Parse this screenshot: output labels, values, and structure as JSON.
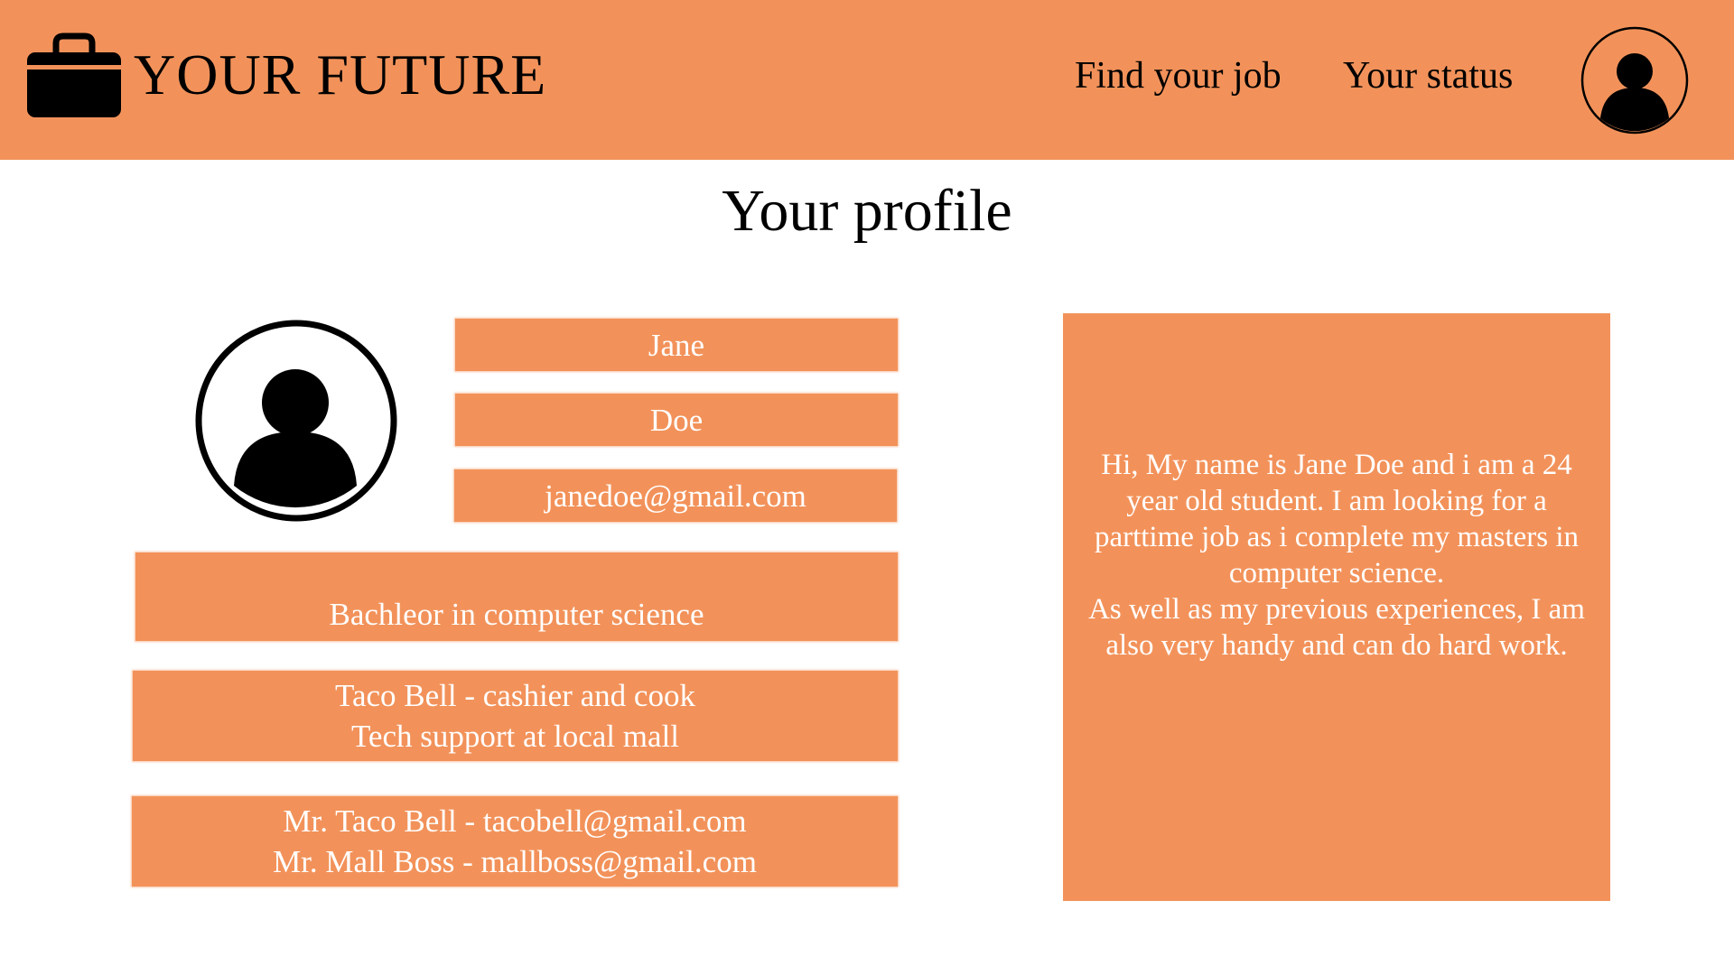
{
  "header": {
    "brand_icon": "briefcase-icon",
    "brand_name": "YOUR FUTURE",
    "nav": {
      "find_job": "Find your job",
      "status": "Your status"
    },
    "avatar_icon": "user-avatar-icon"
  },
  "page": {
    "title": "Your profile"
  },
  "profile": {
    "photo_icon": "user-avatar-icon",
    "first_name": "Jane",
    "last_name": "Doe",
    "email": "janedoe@gmail.com",
    "education": "Bachleor in computer science",
    "experience": [
      "Taco Bell - cashier and cook",
      "Tech support at local mall"
    ],
    "references": [
      "Mr. Taco Bell - tacobell@gmail.com",
      "Mr. Mall Boss - mallboss@gmail.com"
    ],
    "bio": [
      "Hi, My name is Jane Doe and i am a 24 year old student. I am looking for a parttime job as i complete my masters in computer science.",
      "As well as my previous experiences, I am also very handy and can do hard work."
    ]
  },
  "colors": {
    "accent": "#f2925a",
    "text_on_accent": "#ffffff",
    "background": "#ffffff",
    "text": "#000000"
  }
}
